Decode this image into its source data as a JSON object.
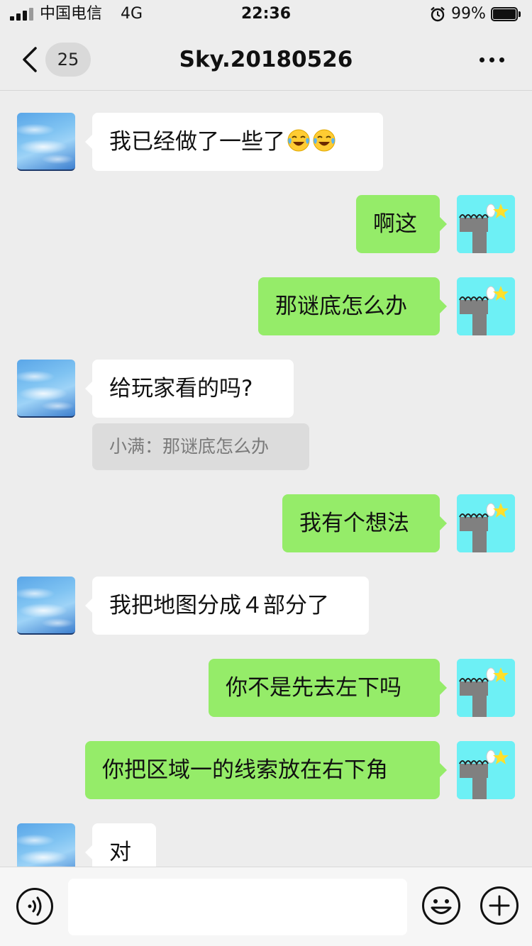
{
  "status_bar": {
    "carrier": "中国电信",
    "network": "4G",
    "time": "22:36",
    "battery": "99%"
  },
  "nav": {
    "unread_count": "25",
    "title": "Sky.20180526"
  },
  "messages": [
    {
      "side": "in",
      "text": "我已经做了一些了",
      "emoji": [
        "face-with-tears-of-joy",
        "face-with-tears-of-joy"
      ]
    },
    {
      "side": "out",
      "text": "啊这"
    },
    {
      "side": "out",
      "text": "那谜底怎么办"
    },
    {
      "side": "in",
      "text": "给玩家看的吗?",
      "quote": "小满：那谜底怎么办"
    },
    {
      "side": "out",
      "text": "我有个想法"
    },
    {
      "side": "in",
      "text": "我把地图分成４部分了"
    },
    {
      "side": "out",
      "text": "你不是先去左下吗"
    },
    {
      "side": "out",
      "text": "你把区域一的线索放在右下角"
    },
    {
      "side": "in",
      "text": "对"
    }
  ],
  "input": {
    "value": "",
    "placeholder": ""
  },
  "colors": {
    "background": "#ededed",
    "outgoing_bubble": "#95ec69",
    "incoming_bubble": "#ffffff",
    "quote_background": "#dcdcdc"
  }
}
